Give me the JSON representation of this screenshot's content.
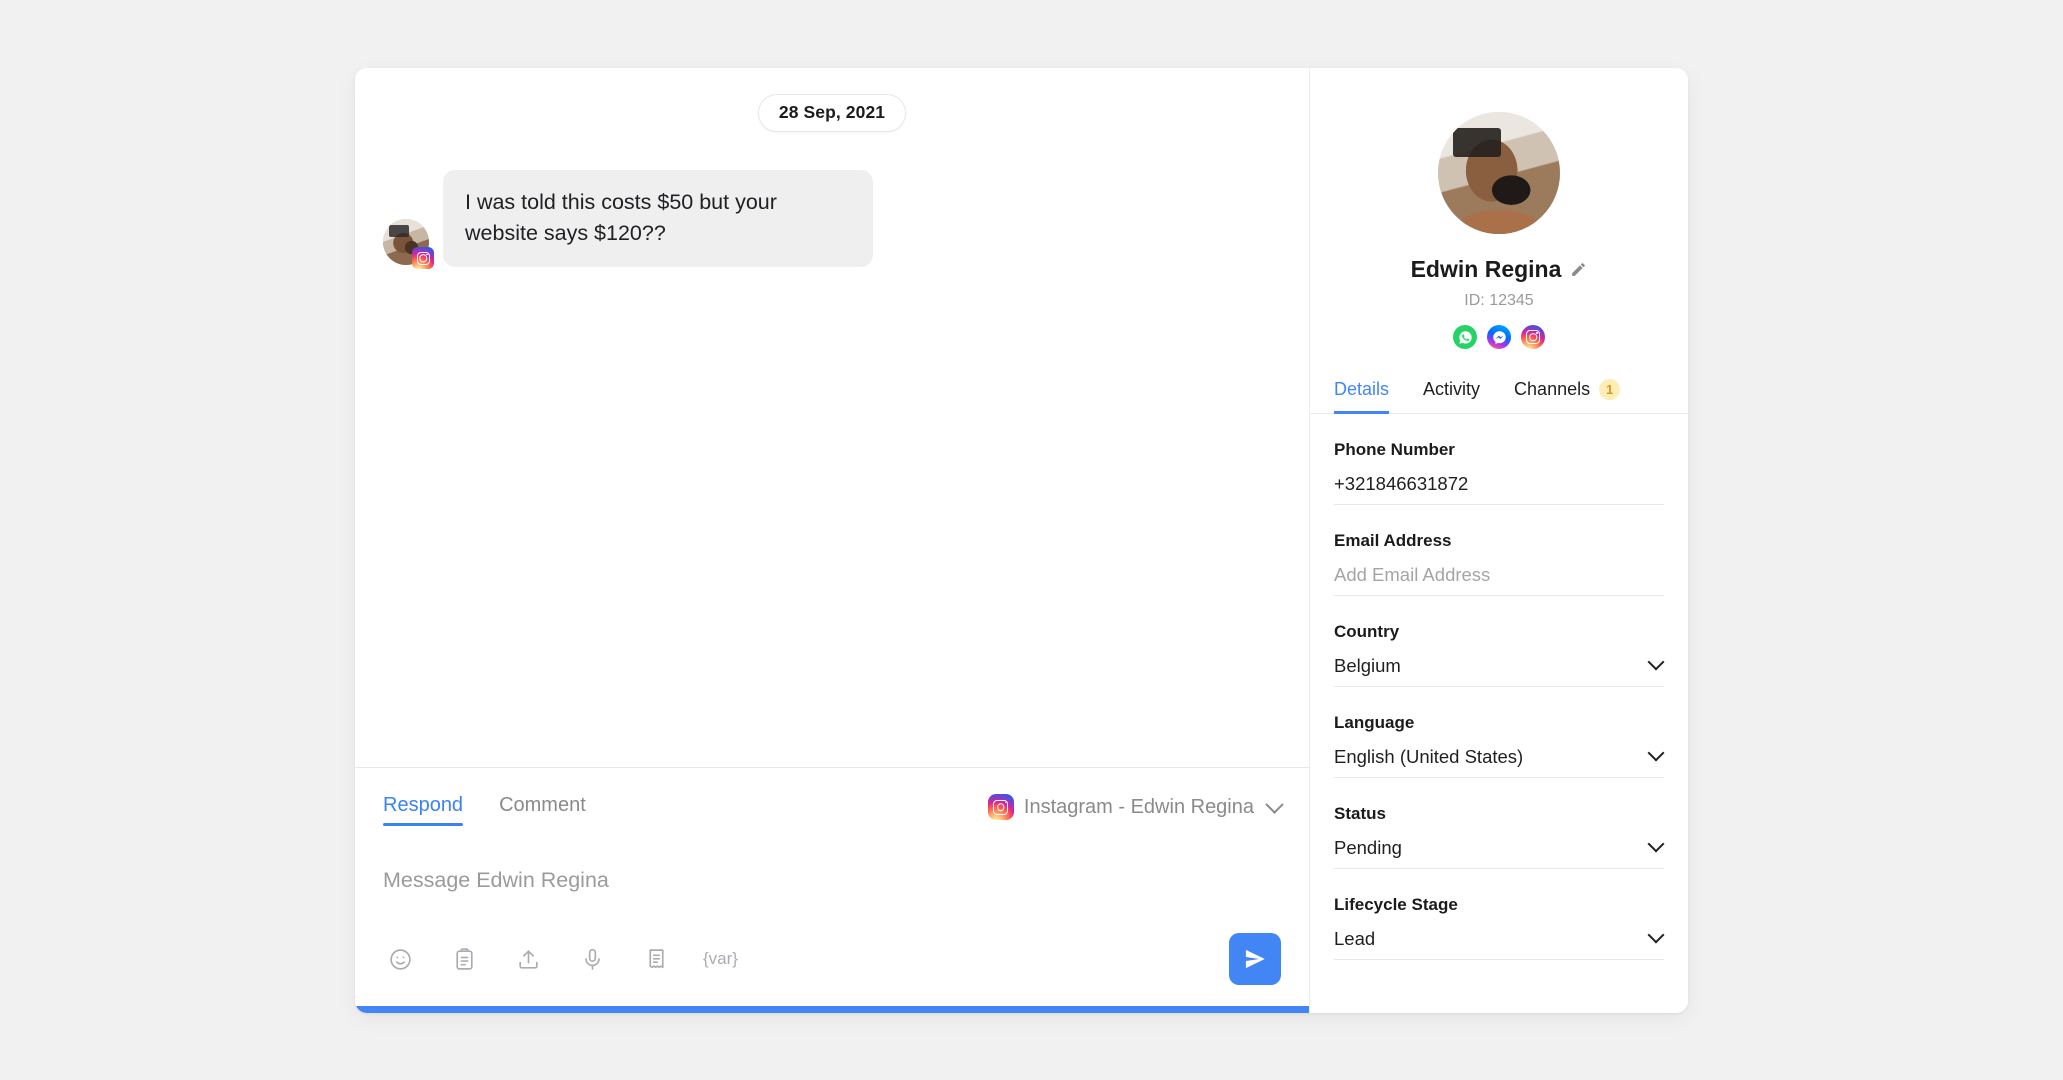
{
  "conversation": {
    "date_divider": "28 Sep, 2021",
    "messages": [
      {
        "sender": "Edwin Regina",
        "channel_icon": "instagram-icon",
        "text": "I was told this costs $50 but your website says $120??"
      }
    ]
  },
  "composer": {
    "tabs": [
      {
        "label": "Respond",
        "active": true
      },
      {
        "label": "Comment",
        "active": false
      }
    ],
    "channel_selector": {
      "icon": "instagram-icon",
      "label": "Instagram - Edwin Regina",
      "chevron": "chevron-down-icon"
    },
    "input_placeholder": "Message Edwin Regina",
    "input_value": "",
    "tools": [
      {
        "name": "emoji-icon",
        "label": "Emoji"
      },
      {
        "name": "clipboard-icon",
        "label": "Saved replies"
      },
      {
        "name": "upload-icon",
        "label": "Upload file"
      },
      {
        "name": "microphone-icon",
        "label": "Voice note"
      },
      {
        "name": "note-icon",
        "label": "Note"
      },
      {
        "name": "variable-icon",
        "label": "{var}"
      }
    ],
    "send_button": "send-icon"
  },
  "profile": {
    "avatar": "contact-avatar",
    "name": "Edwin Regina",
    "edit_icon": "pencil-icon",
    "id_label": "ID: 12345",
    "channels": [
      {
        "name": "whatsapp-icon",
        "color": "#25d366"
      },
      {
        "name": "messenger-icon",
        "color": "#006aff"
      },
      {
        "name": "instagram-icon",
        "color": "#d6249f"
      }
    ],
    "tabs": [
      {
        "label": "Details",
        "active": true,
        "badge": null
      },
      {
        "label": "Activity",
        "active": false,
        "badge": null
      },
      {
        "label": "Channels",
        "active": false,
        "badge": "1"
      }
    ],
    "fields": [
      {
        "label": "Phone Number",
        "value": "+321846631872",
        "is_placeholder": false,
        "has_chevron": false
      },
      {
        "label": "Email Address",
        "value": "Add Email Address",
        "is_placeholder": true,
        "has_chevron": false
      },
      {
        "label": "Country",
        "value": "Belgium",
        "is_placeholder": false,
        "has_chevron": true
      },
      {
        "label": "Language",
        "value": "English (United States)",
        "is_placeholder": false,
        "has_chevron": true
      },
      {
        "label": "Status",
        "value": "Pending",
        "is_placeholder": false,
        "has_chevron": true
      },
      {
        "label": "Lifecycle Stage",
        "value": "Lead",
        "is_placeholder": false,
        "has_chevron": true
      }
    ]
  },
  "colors": {
    "accent": "#4285f4",
    "background": "#f1f1f1",
    "surface": "#ffffff",
    "bubble": "#efefef",
    "badge_bg": "#fdeeb8",
    "badge_text": "#e8911d"
  }
}
